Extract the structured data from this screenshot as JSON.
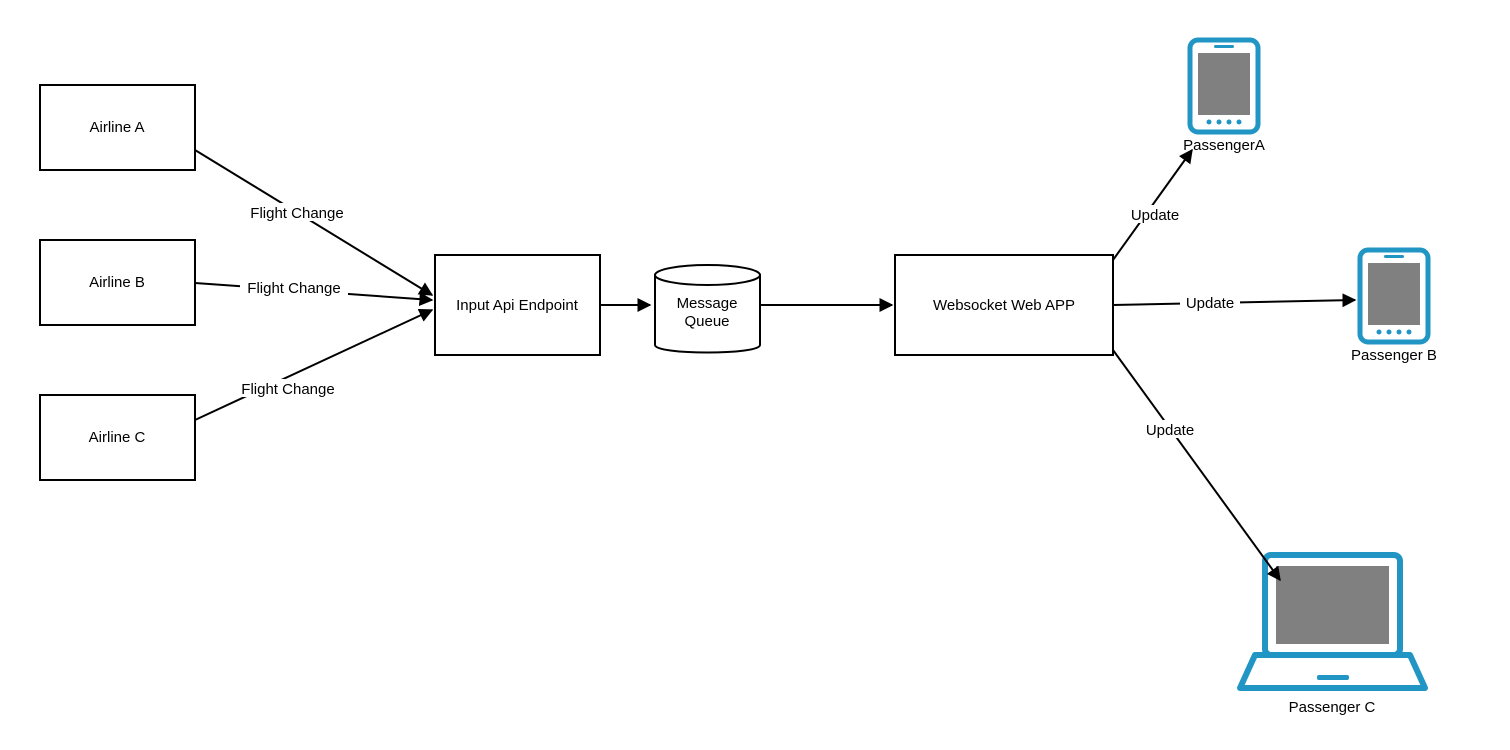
{
  "nodes": {
    "airlineA": "Airline A",
    "airlineB": "Airline B",
    "airlineC": "Airline C",
    "inputApi": "Input Api Endpoint",
    "queueLine1": "Message",
    "queueLine2": "Queue",
    "websocket": "Websocket Web APP",
    "passengerA": "PassengerA",
    "passengerB": "Passenger B",
    "passengerC": "Passenger C"
  },
  "edges": {
    "flightChange": "Flight Change",
    "update": "Update"
  },
  "colors": {
    "deviceBlue": "#2196c4",
    "deviceScreen": "#808080",
    "stroke": "#000000",
    "bg": "#ffffff"
  }
}
